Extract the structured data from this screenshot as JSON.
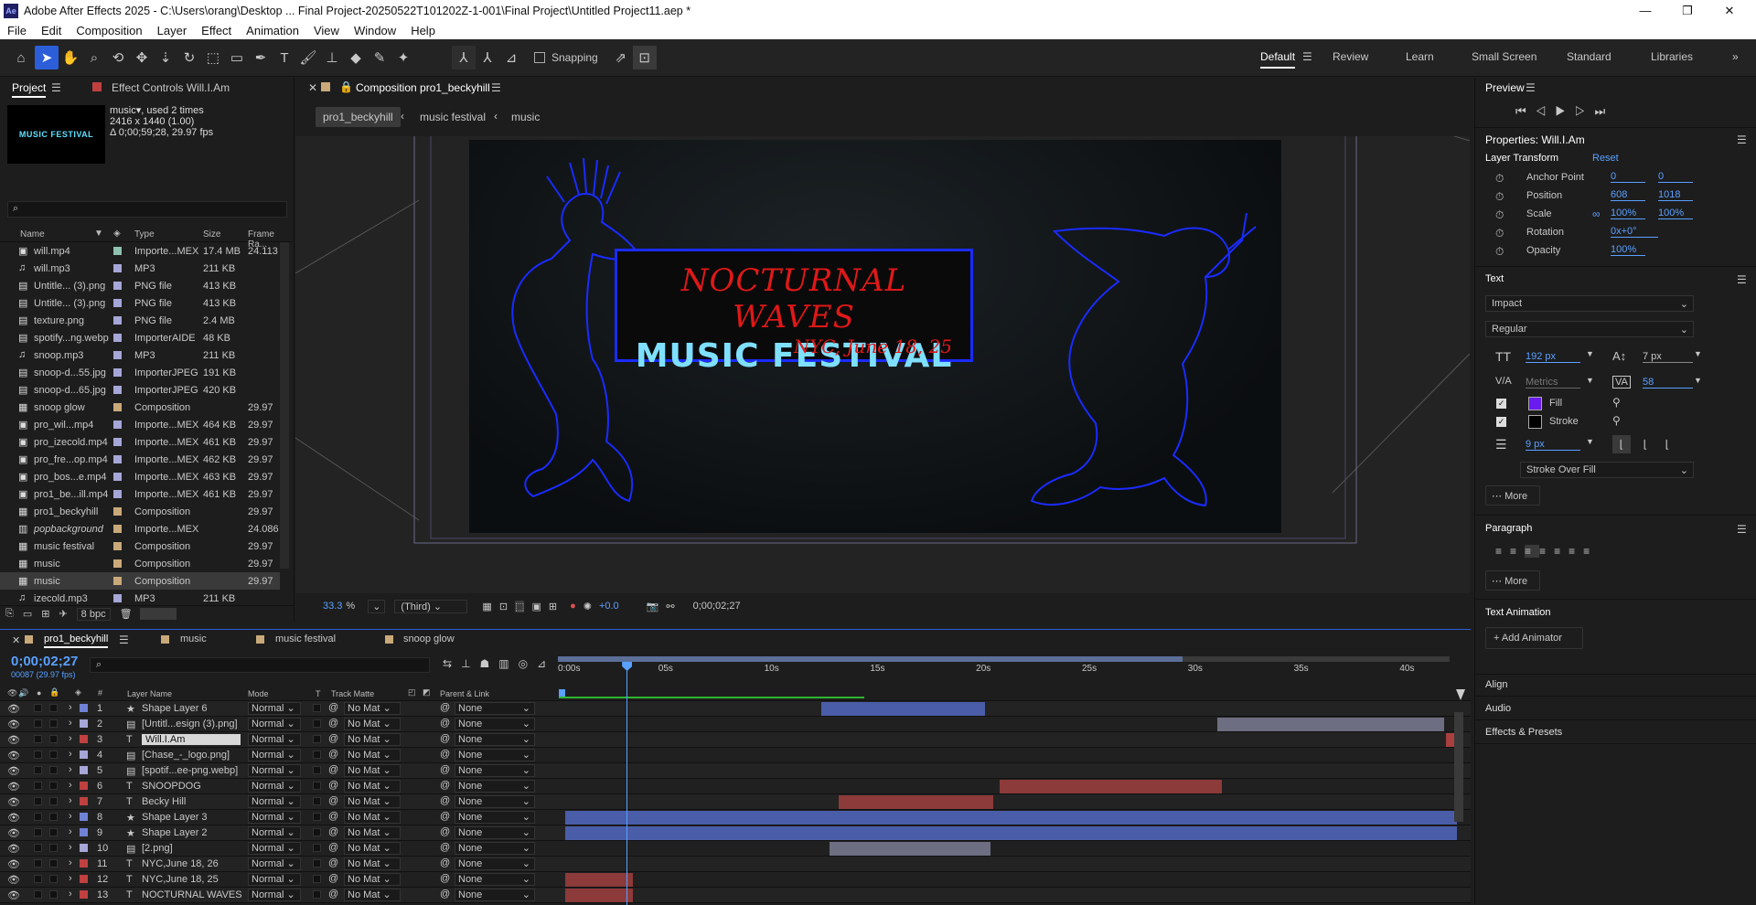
{
  "window": {
    "title": "Adobe After Effects 2025 - C:\\Users\\orang\\Desktop ... Final Project-20250522T101202Z-1-001\\Final Project\\Untitled Project11.aep *",
    "app_icon": "Ae",
    "controls": [
      "minimize-icon",
      "maximize-icon",
      "close-icon"
    ]
  },
  "menu": [
    "File",
    "Edit",
    "Composition",
    "Layer",
    "Effect",
    "Animation",
    "View",
    "Window",
    "Help"
  ],
  "toolbar": {
    "snapping_label": "Snapping",
    "workspaces": [
      "Default",
      "Review",
      "Learn",
      "Small Screen",
      "Standard",
      "Libraries"
    ],
    "active_workspace": "Default"
  },
  "project": {
    "tab": "Project",
    "effect_controls_tab": "Effect Controls Will.I.Am",
    "thumb_text": "MUSIC FESTIVAL",
    "selected_name": "music",
    "used": ", used 2 times",
    "dims": "2416 x 1440 (1.00)",
    "duration": "Δ 0;00;59;28, 29.97 fps",
    "search_placeholder": "",
    "columns": {
      "name": "Name",
      "type": "Type",
      "size": "Size",
      "frame": "Frame Ra..."
    },
    "items": [
      {
        "name": "will.mp4",
        "type": "Importe...MEX",
        "size": "17.4 MB",
        "frame": "24.113",
        "label": "#8fc0b0",
        "icon": "video"
      },
      {
        "name": "will.mp3",
        "type": "MP3",
        "size": "211 KB",
        "frame": "",
        "label": "#a6a6d8",
        "icon": "audio"
      },
      {
        "name": "Untitle... (3).png",
        "type": "PNG file",
        "size": "413 KB",
        "frame": "",
        "label": "#a6a6d8",
        "icon": "image"
      },
      {
        "name": "Untitle... (3).png",
        "type": "PNG file",
        "size": "413 KB",
        "frame": "",
        "label": "#a6a6d8",
        "icon": "image"
      },
      {
        "name": "texture.png",
        "type": "PNG file",
        "size": "2.4 MB",
        "frame": "",
        "label": "#a6a6d8",
        "icon": "image"
      },
      {
        "name": "spotify...ng.webp",
        "type": "ImporterAIDE",
        "size": "48 KB",
        "frame": "",
        "label": "#a6a6d8",
        "icon": "image"
      },
      {
        "name": "snoop.mp3",
        "type": "MP3",
        "size": "211 KB",
        "frame": "",
        "label": "#a6a6d8",
        "icon": "audio"
      },
      {
        "name": "snoop-d...55.jpg",
        "type": "ImporterJPEG",
        "size": "191 KB",
        "frame": "",
        "label": "#a6a6d8",
        "icon": "image"
      },
      {
        "name": "snoop-d...65.jpg",
        "type": "ImporterJPEG",
        "size": "420 KB",
        "frame": "",
        "label": "#a6a6d8",
        "icon": "image"
      },
      {
        "name": "snoop glow",
        "type": "Composition",
        "size": "",
        "frame": "29.97",
        "label": "#c9a97a",
        "icon": "comp"
      },
      {
        "name": "pro_wil...mp4",
        "type": "Importe...MEX",
        "size": "464 KB",
        "frame": "29.97",
        "label": "#a6a6d8",
        "icon": "video"
      },
      {
        "name": "pro_izecold.mp4",
        "type": "Importe...MEX",
        "size": "461 KB",
        "frame": "29.97",
        "label": "#a6a6d8",
        "icon": "video"
      },
      {
        "name": "pro_fre...op.mp4",
        "type": "Importe...MEX",
        "size": "462 KB",
        "frame": "29.97",
        "label": "#a6a6d8",
        "icon": "video"
      },
      {
        "name": "pro_bos...e.mp4",
        "type": "Importe...MEX",
        "size": "463 KB",
        "frame": "29.97",
        "label": "#a6a6d8",
        "icon": "video"
      },
      {
        "name": "pro1_be...ill.mp4",
        "type": "Importe...MEX",
        "size": "461 KB",
        "frame": "29.97",
        "label": "#a6a6d8",
        "icon": "video"
      },
      {
        "name": "pro1_beckyhill",
        "type": "Composition",
        "size": "",
        "frame": "29.97",
        "label": "#c9a97a",
        "icon": "comp"
      },
      {
        "name": "popbackground",
        "type": "Importe...MEX",
        "size": "",
        "frame": "24.086",
        "label": "#c9a97a",
        "icon": "footage"
      },
      {
        "name": "music festival",
        "type": "Composition",
        "size": "",
        "frame": "29.97",
        "label": "#c9a97a",
        "icon": "comp"
      },
      {
        "name": "music",
        "type": "Composition",
        "size": "",
        "frame": "29.97",
        "label": "#c9a97a",
        "icon": "comp"
      },
      {
        "name": "music",
        "type": "Composition",
        "size": "",
        "frame": "29.97",
        "label": "#c9a97a",
        "icon": "comp"
      },
      {
        "name": "izecold.mp3",
        "type": "MP3",
        "size": "211 KB",
        "frame": "",
        "label": "#a6a6d8",
        "icon": "audio"
      }
    ],
    "bpc": "8 bpc"
  },
  "composition": {
    "tab": "Composition pro1_beckyhill",
    "breadcrumbs": [
      "pro1_beckyhill",
      "music festival",
      "music"
    ],
    "title_line1": "NOCTURNAL WAVES",
    "title_line2": "MUSIC FESTIVAL",
    "title_line3": "NYC, June 18, 25",
    "zoom": "33.3",
    "zoom_unit": "%",
    "resolution": "(Third)",
    "exposure": "+0.0",
    "timecode": "0;00;02;27"
  },
  "preview": {
    "title": "Preview"
  },
  "properties": {
    "title": "Properties: Will.I.Am",
    "layer_transform": "Layer Transform",
    "reset": "Reset",
    "anchor_label": "Anchor Point",
    "anchor_x": "0",
    "anchor_y": "0",
    "position_label": "Position",
    "position_x": "608",
    "position_y": "1018",
    "scale_label": "Scale",
    "scale_x": "100%",
    "scale_y": "100%",
    "rotation_label": "Rotation",
    "rotation": "0x+0°",
    "opacity_label": "Opacity",
    "opacity": "100%",
    "text_section": "Text",
    "font": "Impact",
    "style": "Regular",
    "font_size": "192 px",
    "leading": "7 px",
    "kerning": "Metrics",
    "tracking": "58",
    "fill_label": "Fill",
    "stroke_label": "Stroke",
    "fill_color": "#6a1cf0",
    "stroke_width": "9 px",
    "stroke_mode": "Stroke Over Fill",
    "more": "More",
    "paragraph": "Paragraph",
    "text_animation": "Text Animation",
    "add_animator": "Add Animator",
    "align": "Align",
    "audio": "Audio",
    "effects_presets": "Effects & Presets"
  },
  "timeline": {
    "tabs": [
      "pro1_beckyhill",
      "music",
      "music festival",
      "snoop glow"
    ],
    "timecode": "0;00;02;27",
    "frame_info": "00087 (29.97 fps)",
    "search_placeholder": "",
    "columns": {
      "layer_name": "Layer Name",
      "mode": "Mode",
      "t": "T",
      "track_matte": "Track Matte",
      "parent": "Parent & Link"
    },
    "ruler": [
      "0:00s",
      "05s",
      "10s",
      "15s",
      "20s",
      "25s",
      "30s",
      "35s",
      "40s"
    ],
    "layers": [
      {
        "num": "1",
        "type": "★",
        "name": "Shape Layer 6",
        "label": "#6f82d6",
        "mode": "Normal",
        "matte": "No Mat",
        "parent": "None",
        "bar_start": 12.1,
        "bar_end": 19.8,
        "bar_color": "#4a5da8"
      },
      {
        "num": "2",
        "type": "img",
        "name": "[Untitl...esign (3).png]",
        "label": "#a6a6d8",
        "mode": "Normal",
        "matte": "No Mat",
        "parent": "None",
        "bar_start": 30.8,
        "bar_end": 41.5,
        "bar_color": "#6e6e82"
      },
      {
        "num": "3",
        "type": "T",
        "name": "Will.I.Am",
        "label": "#c04040",
        "mode": "Normal",
        "matte": "No Mat",
        "parent": "None",
        "bar_start": 41.6,
        "bar_end": 42.1,
        "bar_color": "#a84040",
        "selected": true
      },
      {
        "num": "4",
        "type": "img",
        "name": "[Chase_-_logo.png]",
        "label": "#a6a6d8",
        "mode": "Normal",
        "matte": "No Mat",
        "parent": "None",
        "bar_start": 0,
        "bar_end": 0,
        "bar_color": "#6e6e82"
      },
      {
        "num": "5",
        "type": "img",
        "name": "[spotif...ee-png.webp]",
        "label": "#a6a6d8",
        "mode": "Normal",
        "matte": "No Mat",
        "parent": "None",
        "bar_start": 0,
        "bar_end": 0,
        "bar_color": "#6e6e82"
      },
      {
        "num": "6",
        "type": "T",
        "name": "SNOOPDOG",
        "label": "#c04040",
        "mode": "Normal",
        "matte": "No Mat",
        "parent": "None",
        "bar_start": 20.5,
        "bar_end": 31.0,
        "bar_color": "#8c3a3a"
      },
      {
        "num": "7",
        "type": "T",
        "name": "Becky Hill",
        "label": "#c04040",
        "mode": "Normal",
        "matte": "No Mat",
        "parent": "None",
        "bar_start": 12.9,
        "bar_end": 20.2,
        "bar_color": "#8c3a3a"
      },
      {
        "num": "8",
        "type": "★",
        "name": "Shape Layer 3",
        "label": "#6f82d6",
        "mode": "Normal",
        "matte": "No Mat",
        "parent": "None",
        "bar_start": 0,
        "bar_end": 42.1,
        "bar_color": "#4a5da8"
      },
      {
        "num": "9",
        "type": "★",
        "name": "Shape Layer 2",
        "label": "#6f82d6",
        "mode": "Normal",
        "matte": "No Mat",
        "parent": "None",
        "bar_start": 0,
        "bar_end": 42.1,
        "bar_color": "#4a5da8"
      },
      {
        "num": "10",
        "type": "img",
        "name": "[2.png]",
        "label": "#a6a6d8",
        "mode": "Normal",
        "matte": "No Mat",
        "parent": "None",
        "bar_start": 12.5,
        "bar_end": 20.1,
        "bar_color": "#6e6e82"
      },
      {
        "num": "11",
        "type": "T",
        "name": "NYC,June 18, 26",
        "label": "#c04040",
        "mode": "Normal",
        "matte": "No Mat",
        "parent": "None",
        "bar_start": 0,
        "bar_end": 0,
        "bar_color": "#8c3a3a"
      },
      {
        "num": "12",
        "type": "T",
        "name": "NYC,June 18, 25",
        "label": "#c04040",
        "mode": "Normal",
        "matte": "No Mat",
        "parent": "None",
        "bar_start": 0,
        "bar_end": 3.2,
        "bar_color": "#8c3a3a"
      },
      {
        "num": "13",
        "type": "T",
        "name": "NOCTURNAL WAVES",
        "label": "#c04040",
        "mode": "Normal",
        "matte": "No Mat",
        "parent": "None",
        "bar_start": 0,
        "bar_end": 3.2,
        "bar_color": "#8c3a3a"
      }
    ],
    "playhead_seconds": 2.9,
    "work_area_end": 29.5
  },
  "colors": {
    "accent": "#2b5ed8",
    "link_blue": "#5aa0ff",
    "canvas_bg": "#0d1114",
    "outline_blue": "#1a2bff",
    "title_red": "#e01818",
    "title_cyan": "#7fdfff"
  }
}
